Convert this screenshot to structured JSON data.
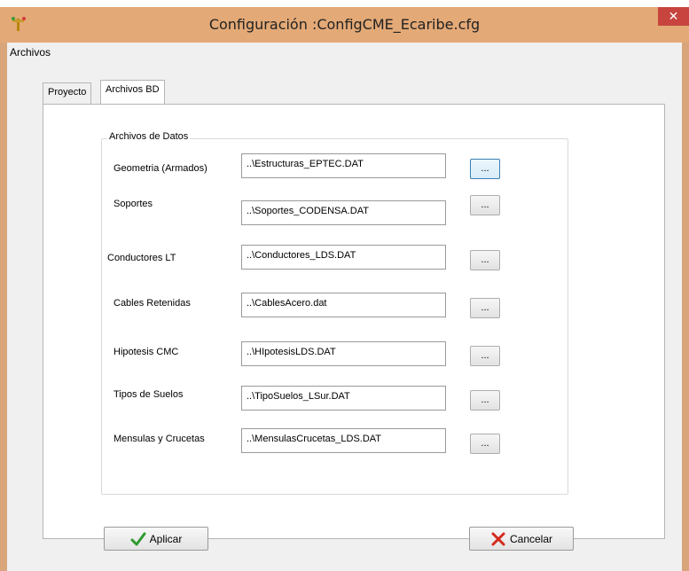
{
  "window": {
    "title": "Configuración :ConfigCME_Ecaribe.cfg",
    "close_glyph": "✕"
  },
  "menubar": {
    "items": [
      "Archivos"
    ]
  },
  "tabs": [
    {
      "label": "Proyecto",
      "active": false
    },
    {
      "label": "Archivos BD",
      "active": true
    }
  ],
  "group": {
    "label": "Archivos de Datos"
  },
  "fields": [
    {
      "label": "Geometria (Armados)",
      "value": "..\\Estructuras_EPTEC.DAT"
    },
    {
      "label": "Soportes",
      "value": "..\\Soportes_CODENSA.DAT"
    },
    {
      "label": "Conductores LT",
      "value": "..\\Conductores_LDS.DAT"
    },
    {
      "label": "Cables Retenidas",
      "value": "..\\CablesAcero.dat"
    },
    {
      "label": "Hipotesis CMC",
      "value": "..\\HIpotesisLDS.DAT"
    },
    {
      "label": "Tipos de Suelos",
      "value": "..\\TipoSuelos_LSur.DAT"
    },
    {
      "label": "Mensulas y Crucetas",
      "value": "..\\MensulasCrucetas_LDS.DAT"
    }
  ],
  "browse_label": "...",
  "buttons": {
    "apply": "Aplicar",
    "cancel": "Cancelar"
  },
  "colors": {
    "titlebar": "#e3a976",
    "close": "#c8443f",
    "check": "#2e9a2e",
    "cross": "#d42a1c"
  },
  "icons": {
    "app": "app-icon",
    "apply": "checkmark-icon",
    "cancel": "cross-icon"
  }
}
